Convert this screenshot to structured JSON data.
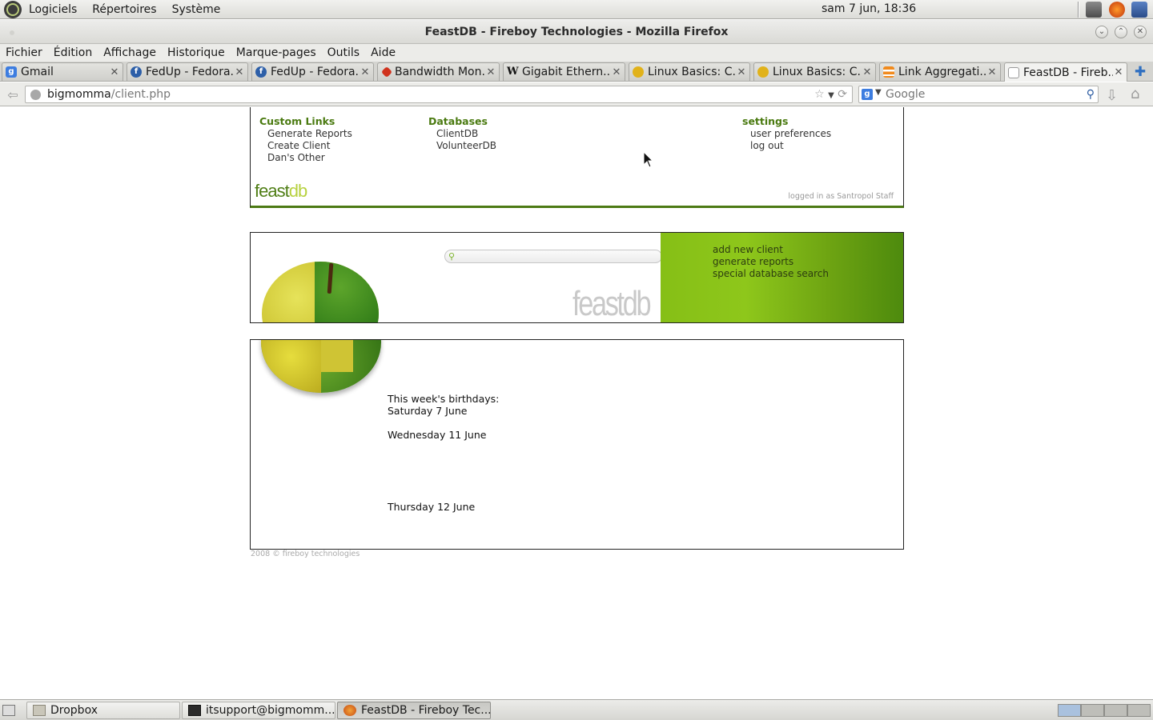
{
  "top_panel": {
    "menus": [
      "Logiciels",
      "Répertoires",
      "Système"
    ],
    "clock": "sam  7 jun, 18:36"
  },
  "window": {
    "title": "FeastDB - Fireboy Technologies - Mozilla Firefox"
  },
  "menubar": [
    "Fichier",
    "Édition",
    "Affichage",
    "Historique",
    "Marque-pages",
    "Outils",
    "Aide"
  ],
  "tabs": [
    {
      "label": "Gmail",
      "icon": "google-icon"
    },
    {
      "label": "FedUp - Fedora...",
      "icon": "fedora-icon"
    },
    {
      "label": "FedUp - Fedora...",
      "icon": "fedora-icon"
    },
    {
      "label": "Bandwidth Mon...",
      "icon": "red-diamond-icon"
    },
    {
      "label": "Gigabit Ethern...",
      "icon": "wikipedia-icon"
    },
    {
      "label": "Linux Basics: C...",
      "icon": "tux-icon"
    },
    {
      "label": "Linux Basics: C...",
      "icon": "tux-icon"
    },
    {
      "label": "Link Aggregati...",
      "icon": "orange-bars-icon"
    },
    {
      "label": "FeastDB - Fireb...",
      "icon": "blank-page-icon"
    }
  ],
  "navbar": {
    "url_host": "bigmomma",
    "url_path": "/client.php",
    "search_placeholder": "Google"
  },
  "page": {
    "custom_links": {
      "heading": "Custom Links",
      "items": [
        "Generate Reports",
        "Create Client",
        "Dan's Other"
      ]
    },
    "databases": {
      "heading": "Databases",
      "items": [
        "ClientDB",
        "VolunteerDB"
      ]
    },
    "settings": {
      "heading": "settings",
      "items": [
        "user preferences",
        "log out"
      ]
    },
    "logo_feast": "feast",
    "logo_db": "db",
    "logged_in": "logged in as Santropol Staff",
    "big_logo_feast": "feast",
    "big_logo_db": "db",
    "quick_links": [
      "add new client",
      "generate reports",
      "special database search"
    ],
    "birthdays": {
      "heading": "This week's birthdays:",
      "days": [
        "Saturday 7 June",
        "Wednesday 11 June",
        "Thursday 12 June"
      ]
    },
    "copyright": "2008 © fireboy technologies"
  },
  "taskbar": {
    "tasks": [
      "Dropbox",
      "itsupport@bigmomm...",
      "FeastDB - Fireboy Tec..."
    ]
  },
  "colors": {
    "brand_dark_green": "#4a7a10",
    "brand_light_green": "#86bf16"
  }
}
